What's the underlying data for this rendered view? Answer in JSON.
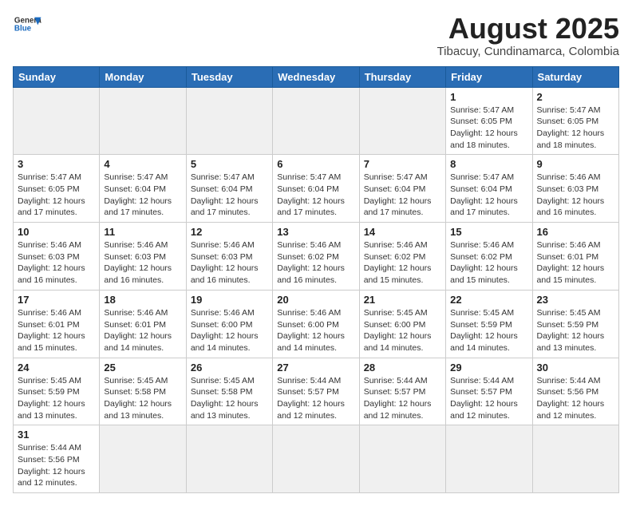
{
  "logo": {
    "text_general": "General",
    "text_blue": "Blue"
  },
  "title": "August 2025",
  "subtitle": "Tibacuy, Cundinamarca, Colombia",
  "weekdays": [
    "Sunday",
    "Monday",
    "Tuesday",
    "Wednesday",
    "Thursday",
    "Friday",
    "Saturday"
  ],
  "weeks": [
    [
      {
        "day": "",
        "info": ""
      },
      {
        "day": "",
        "info": ""
      },
      {
        "day": "",
        "info": ""
      },
      {
        "day": "",
        "info": ""
      },
      {
        "day": "",
        "info": ""
      },
      {
        "day": "1",
        "info": "Sunrise: 5:47 AM\nSunset: 6:05 PM\nDaylight: 12 hours and 18 minutes."
      },
      {
        "day": "2",
        "info": "Sunrise: 5:47 AM\nSunset: 6:05 PM\nDaylight: 12 hours and 18 minutes."
      }
    ],
    [
      {
        "day": "3",
        "info": "Sunrise: 5:47 AM\nSunset: 6:05 PM\nDaylight: 12 hours and 17 minutes."
      },
      {
        "day": "4",
        "info": "Sunrise: 5:47 AM\nSunset: 6:04 PM\nDaylight: 12 hours and 17 minutes."
      },
      {
        "day": "5",
        "info": "Sunrise: 5:47 AM\nSunset: 6:04 PM\nDaylight: 12 hours and 17 minutes."
      },
      {
        "day": "6",
        "info": "Sunrise: 5:47 AM\nSunset: 6:04 PM\nDaylight: 12 hours and 17 minutes."
      },
      {
        "day": "7",
        "info": "Sunrise: 5:47 AM\nSunset: 6:04 PM\nDaylight: 12 hours and 17 minutes."
      },
      {
        "day": "8",
        "info": "Sunrise: 5:47 AM\nSunset: 6:04 PM\nDaylight: 12 hours and 17 minutes."
      },
      {
        "day": "9",
        "info": "Sunrise: 5:46 AM\nSunset: 6:03 PM\nDaylight: 12 hours and 16 minutes."
      }
    ],
    [
      {
        "day": "10",
        "info": "Sunrise: 5:46 AM\nSunset: 6:03 PM\nDaylight: 12 hours and 16 minutes."
      },
      {
        "day": "11",
        "info": "Sunrise: 5:46 AM\nSunset: 6:03 PM\nDaylight: 12 hours and 16 minutes."
      },
      {
        "day": "12",
        "info": "Sunrise: 5:46 AM\nSunset: 6:03 PM\nDaylight: 12 hours and 16 minutes."
      },
      {
        "day": "13",
        "info": "Sunrise: 5:46 AM\nSunset: 6:02 PM\nDaylight: 12 hours and 16 minutes."
      },
      {
        "day": "14",
        "info": "Sunrise: 5:46 AM\nSunset: 6:02 PM\nDaylight: 12 hours and 15 minutes."
      },
      {
        "day": "15",
        "info": "Sunrise: 5:46 AM\nSunset: 6:02 PM\nDaylight: 12 hours and 15 minutes."
      },
      {
        "day": "16",
        "info": "Sunrise: 5:46 AM\nSunset: 6:01 PM\nDaylight: 12 hours and 15 minutes."
      }
    ],
    [
      {
        "day": "17",
        "info": "Sunrise: 5:46 AM\nSunset: 6:01 PM\nDaylight: 12 hours and 15 minutes."
      },
      {
        "day": "18",
        "info": "Sunrise: 5:46 AM\nSunset: 6:01 PM\nDaylight: 12 hours and 14 minutes."
      },
      {
        "day": "19",
        "info": "Sunrise: 5:46 AM\nSunset: 6:00 PM\nDaylight: 12 hours and 14 minutes."
      },
      {
        "day": "20",
        "info": "Sunrise: 5:46 AM\nSunset: 6:00 PM\nDaylight: 12 hours and 14 minutes."
      },
      {
        "day": "21",
        "info": "Sunrise: 5:45 AM\nSunset: 6:00 PM\nDaylight: 12 hours and 14 minutes."
      },
      {
        "day": "22",
        "info": "Sunrise: 5:45 AM\nSunset: 5:59 PM\nDaylight: 12 hours and 14 minutes."
      },
      {
        "day": "23",
        "info": "Sunrise: 5:45 AM\nSunset: 5:59 PM\nDaylight: 12 hours and 13 minutes."
      }
    ],
    [
      {
        "day": "24",
        "info": "Sunrise: 5:45 AM\nSunset: 5:59 PM\nDaylight: 12 hours and 13 minutes."
      },
      {
        "day": "25",
        "info": "Sunrise: 5:45 AM\nSunset: 5:58 PM\nDaylight: 12 hours and 13 minutes."
      },
      {
        "day": "26",
        "info": "Sunrise: 5:45 AM\nSunset: 5:58 PM\nDaylight: 12 hours and 13 minutes."
      },
      {
        "day": "27",
        "info": "Sunrise: 5:44 AM\nSunset: 5:57 PM\nDaylight: 12 hours and 12 minutes."
      },
      {
        "day": "28",
        "info": "Sunrise: 5:44 AM\nSunset: 5:57 PM\nDaylight: 12 hours and 12 minutes."
      },
      {
        "day": "29",
        "info": "Sunrise: 5:44 AM\nSunset: 5:57 PM\nDaylight: 12 hours and 12 minutes."
      },
      {
        "day": "30",
        "info": "Sunrise: 5:44 AM\nSunset: 5:56 PM\nDaylight: 12 hours and 12 minutes."
      }
    ],
    [
      {
        "day": "31",
        "info": "Sunrise: 5:44 AM\nSunset: 5:56 PM\nDaylight: 12 hours and 12 minutes."
      },
      {
        "day": "",
        "info": ""
      },
      {
        "day": "",
        "info": ""
      },
      {
        "day": "",
        "info": ""
      },
      {
        "day": "",
        "info": ""
      },
      {
        "day": "",
        "info": ""
      },
      {
        "day": "",
        "info": ""
      }
    ]
  ]
}
